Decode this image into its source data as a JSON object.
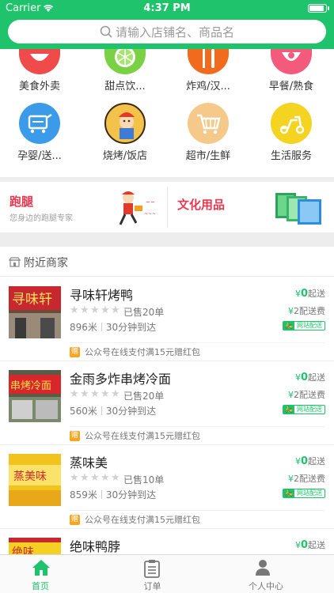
{
  "status": {
    "carrier": "Carrier",
    "time": "4:37 PM"
  },
  "search": {
    "placeholder": "请输入店铺名、商品名"
  },
  "categories": [
    {
      "label": "美食外卖",
      "icon": "bowl-icon",
      "color": "#f04b4b"
    },
    {
      "label": "甜点饮...",
      "icon": "lime-icon",
      "color": "#7bd145"
    },
    {
      "label": "炸鸡/汉...",
      "icon": "fork-knife-icon",
      "color": "#f06b1e"
    },
    {
      "label": "早餐/熟食",
      "icon": "breakfast-icon",
      "color": "#f35a7c"
    },
    {
      "label": "孕婴/送...",
      "icon": "cart-icon",
      "color": "#3b9be8"
    },
    {
      "label": "烧烤/饭店",
      "icon": "chef-icon",
      "color": "#f2c24a"
    },
    {
      "label": "超市/生鲜",
      "icon": "shopping-cart-icon",
      "color": "#f5c98a"
    },
    {
      "label": "生活服务",
      "icon": "scooter-icon",
      "color": "#f4d321"
    }
  ],
  "promos": [
    {
      "title": "跑腿",
      "subtitle": "您身边的跑腿专家",
      "color": "#e8384f",
      "icon": "runner-icon"
    },
    {
      "title": "文化用品",
      "subtitle": "",
      "color": "#e8384f",
      "icon": "books-icon"
    }
  ],
  "nearby": {
    "title": "附近商家",
    "icon": "store-icon"
  },
  "shops": [
    {
      "name": "寻味轩烤鸭",
      "sold": "已售20单",
      "distance": "896米",
      "time": "30分钟到达",
      "min_order": "0",
      "min_label": "起送",
      "fee": "2",
      "fee_label": "配送费",
      "delivery": "网站配送",
      "promo": "公众号在线支付满15元赠红包",
      "promo_tag": "赠",
      "sign": "寻味轩"
    },
    {
      "name": "金雨多炸串烤冷面",
      "sold": "已售20单",
      "distance": "560米",
      "time": "30分钟到达",
      "min_order": "0",
      "min_label": "起送",
      "fee": "2",
      "fee_label": "配送费",
      "delivery": "网站配送",
      "promo": "公众号在线支付满15元赠红包",
      "promo_tag": "赠",
      "sign": "串烤冷面"
    },
    {
      "name": "蒸味美",
      "sold": "已售10单",
      "distance": "859米",
      "time": "30分钟到达",
      "min_order": "0",
      "min_label": "起送",
      "fee": "2",
      "fee_label": "配送费",
      "delivery": "网站配送",
      "promo": "公众号在线支付满15元赠红包",
      "promo_tag": "赠",
      "sign": "蒸美味"
    },
    {
      "name": "绝味鸭脖",
      "sold": "",
      "distance": "",
      "time": "",
      "min_order": "0",
      "min_label": "起送",
      "fee": "",
      "fee_label": "",
      "delivery": "",
      "promo": "",
      "promo_tag": "",
      "sign": "绝味"
    }
  ],
  "tabs": [
    {
      "label": "首页",
      "icon": "home-icon",
      "active": true
    },
    {
      "label": "订单",
      "icon": "order-list-icon",
      "active": false
    },
    {
      "label": "个人中心",
      "icon": "user-icon",
      "active": false
    }
  ],
  "colors": {
    "brand": "#1fc36b",
    "accent_red": "#e8384f"
  }
}
